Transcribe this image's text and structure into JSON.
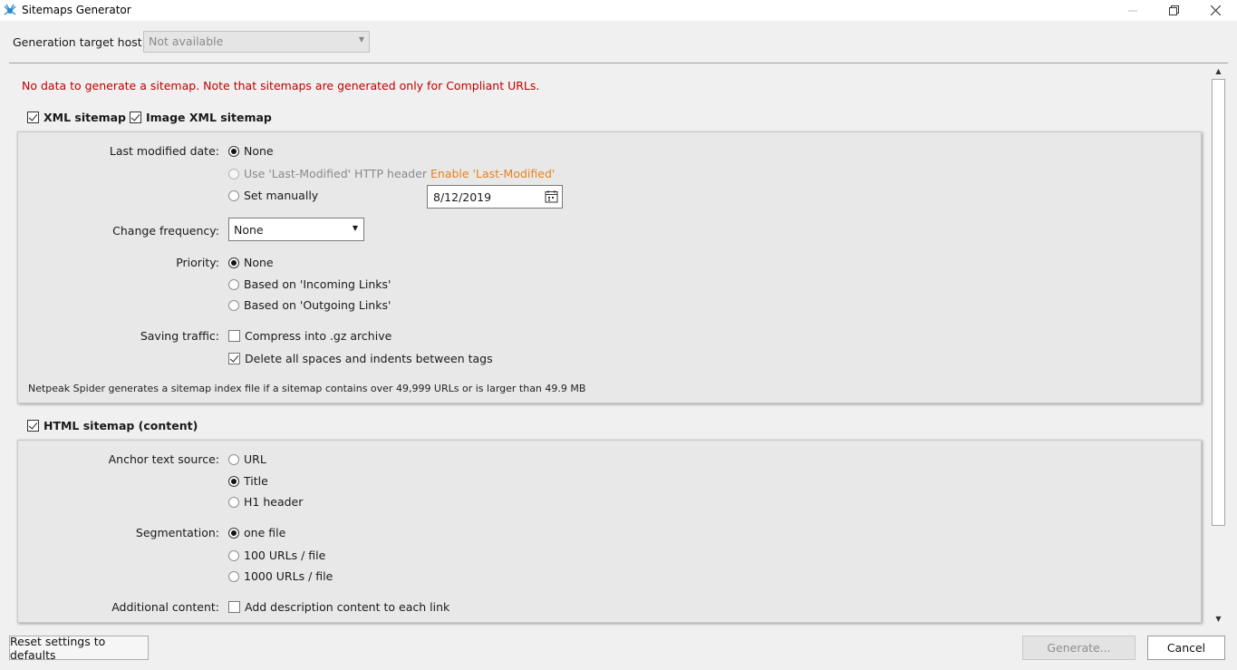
{
  "window": {
    "title": "Sitemaps Generator",
    "controls": {
      "minimize": "minimize-icon",
      "restore": "restore-icon",
      "close": "close-icon"
    }
  },
  "host": {
    "label": "Generation target host:",
    "value": "Not available"
  },
  "warning": "No data to generate a sitemap. Note that sitemaps are generated only for Compliant URLs.",
  "xml": {
    "xml_sitemap_label": "XML sitemap",
    "xml_sitemap_checked": true,
    "image_sitemap_label": "Image XML sitemap",
    "image_sitemap_checked": true,
    "last_modified": {
      "label": "Last modified date:",
      "options": [
        "None",
        "Use 'Last-Modified' HTTP header",
        "Set manually"
      ],
      "selected": "None",
      "enable_link": "Enable 'Last-Modified'",
      "date": "8/12/2019"
    },
    "change_frequency": {
      "label": "Change frequency:",
      "value": "None"
    },
    "priority": {
      "label": "Priority:",
      "options": [
        "None",
        "Based on 'Incoming Links'",
        "Based on 'Outgoing Links'"
      ],
      "selected": "None"
    },
    "saving_traffic": {
      "label": "Saving traffic:",
      "compress_label": "Compress into .gz archive",
      "compress_checked": false,
      "delete_spaces_label": "Delete all spaces and indents between tags",
      "delete_spaces_checked": true
    },
    "note": "Netpeak Spider generates a sitemap index file if a sitemap contains over 49,999 URLs or is larger than 49.9 MB"
  },
  "html": {
    "label": "HTML sitemap (content)",
    "checked": true,
    "anchor": {
      "label": "Anchor text source:",
      "options": [
        "URL",
        "Title",
        "H1 header"
      ],
      "selected": "Title"
    },
    "segmentation": {
      "label": "Segmentation:",
      "options": [
        "one file",
        "100 URLs / file",
        "1000 URLs / file"
      ],
      "selected": "one file"
    },
    "additional": {
      "label": "Additional content:",
      "option": "Add description content to each link",
      "checked": false
    }
  },
  "footer": {
    "reset": "Reset settings to defaults",
    "generate": "Generate...",
    "cancel": "Cancel"
  }
}
